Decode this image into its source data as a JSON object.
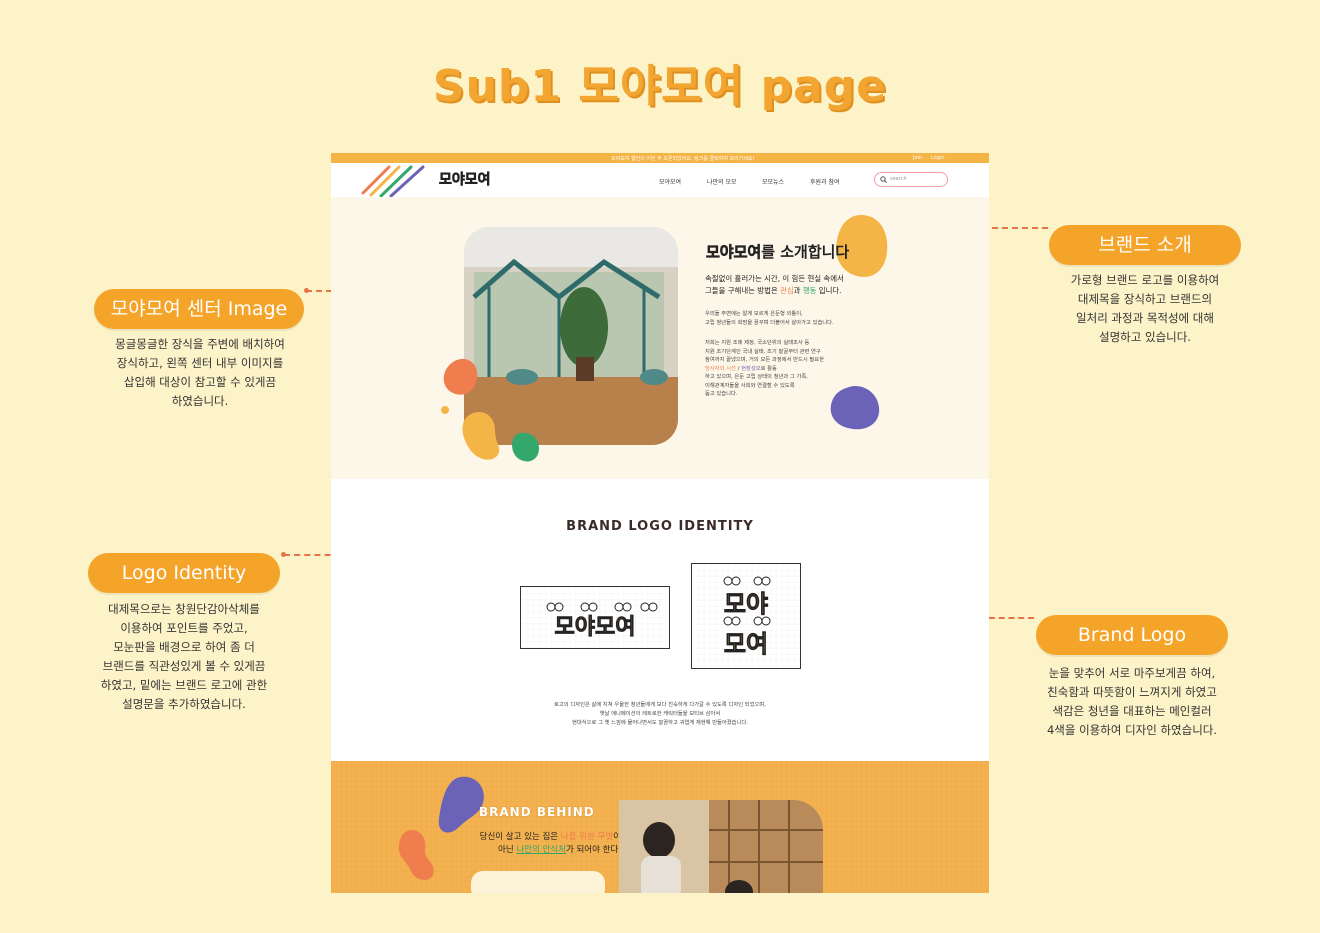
{
  "page_title": "Sub1 모야모여 page",
  "annotations": {
    "brand_intro": {
      "label": "브랜드 소개",
      "text": "가로형 브랜드 로고를 이용하여\n대제목을 장식하고 브랜드의\n일처리 과정과 목적성에 대해\n설명하고 있습니다."
    },
    "center_image": {
      "label": "모야모여 센터 Image",
      "text": "몽글몽글한 장식을 주변에 배치하여\n장식하고, 왼쪽 센터 내부 이미지를\n삽입해 대상이 참고할 수 있게끔\n하였습니다."
    },
    "logo_identity": {
      "label": "Logo Identity",
      "text": "대제목으로는 창원단감아삭체를\n이용하여 포인트를 주었고,\n모눈판을 배경으로 하여 좀 더\n브랜드를 직관성있게 볼 수 있게끔\n하였고, 밑에는 브랜드 로고에 관한\n설명문을 추가하였습니다."
    },
    "brand_logo": {
      "label": "Brand Logo",
      "text": "눈을 맞추어 서로 마주보게끔 하여,\n친숙함과 따뜻함이 느껴지게 하였고\n색감은 청년을 대표하는 메인컬러\n4색을 이용하여 디자인 하였습니다."
    }
  },
  "mockup": {
    "topbar": {
      "notice": "모야모여 웹진이 이번 주 오픈되었어요. 링크를 클릭하여 보러가세요!",
      "join": "Join",
      "login": "Login"
    },
    "nav": {
      "logo": "모야모여",
      "items": [
        "모야모여",
        "나만의 모모",
        "모모뉴스",
        "후원과 참여"
      ],
      "search_placeholder": "search"
    },
    "intro": {
      "title_logo": "모야모여",
      "title_suffix": "를 소개합니다",
      "main_line1": "속절없이 흘러가는 시간, 이 힘든 현실 속에서",
      "main_line2_pre": "그들을 구해내는 방법은 ",
      "highlight1": "관심",
      "main_and": "과 ",
      "highlight2": "행동",
      "main_line2_post": " 입니다.",
      "p1": "우리들 주변에는 알게 모르게 은둔형 외톨이,\n고립 청년들의 희망을 꿈꾸며 더불어서 살아가고 있습니다.",
      "p2": "저희는 지원 조례 제정, 국소단위의 실태조사 등\n지원 조기단계인 국내 실태, 조기 발굴부터 관련 연구\n참여까지 끝냈으며, 거의 모든 과정에서 반드시 필요한",
      "p2_hl1": "당사자의 시선",
      "p2_sep": " / ",
      "p2_hl2": "현장성",
      "p2_tail": "으로 활동",
      "p3": "하고 있으며, 은둔 고립 상태의 청년과 그 가족,\n이해관계자들을 사회와 연결할 수 있도록\n돕고 있습니다."
    },
    "identity": {
      "heading": "BRAND LOGO IDENTITY",
      "logo_horizontal": "모야모여",
      "logo_vertical_top": "모야",
      "logo_vertical_bottom": "모여",
      "desc": "로고의 디자인은 삶에 지쳐 우울한 청년들에게 보다 친숙하게 다가갈 수 있도록 디자인 되었으며,\n옛날 애니메이션의 레트로한 캐릭터들을 모티브 삼아서\n현대식으로 그 옛 느낌에 물어나면서도 깔끔하고 귀엽게 재현해 만들어졌습니다."
    },
    "behind": {
      "heading": "BRAND BEHIND",
      "line1_pre": "당신이 살고 있는 집은 ",
      "line1_hl": "나를 위한 무엇",
      "line1_post": "이",
      "line2_pre": "아닌 ",
      "line2_hl": "나만의 안식처",
      "line2_post": "가 되어야 한다."
    }
  },
  "colors": {
    "background": "#fdf3c8",
    "accent_orange": "#f5a42a",
    "brand_orange": "#ef7d4e",
    "brand_yellow": "#f5b446",
    "brand_green": "#34a86a",
    "brand_purple": "#6a63b8"
  }
}
